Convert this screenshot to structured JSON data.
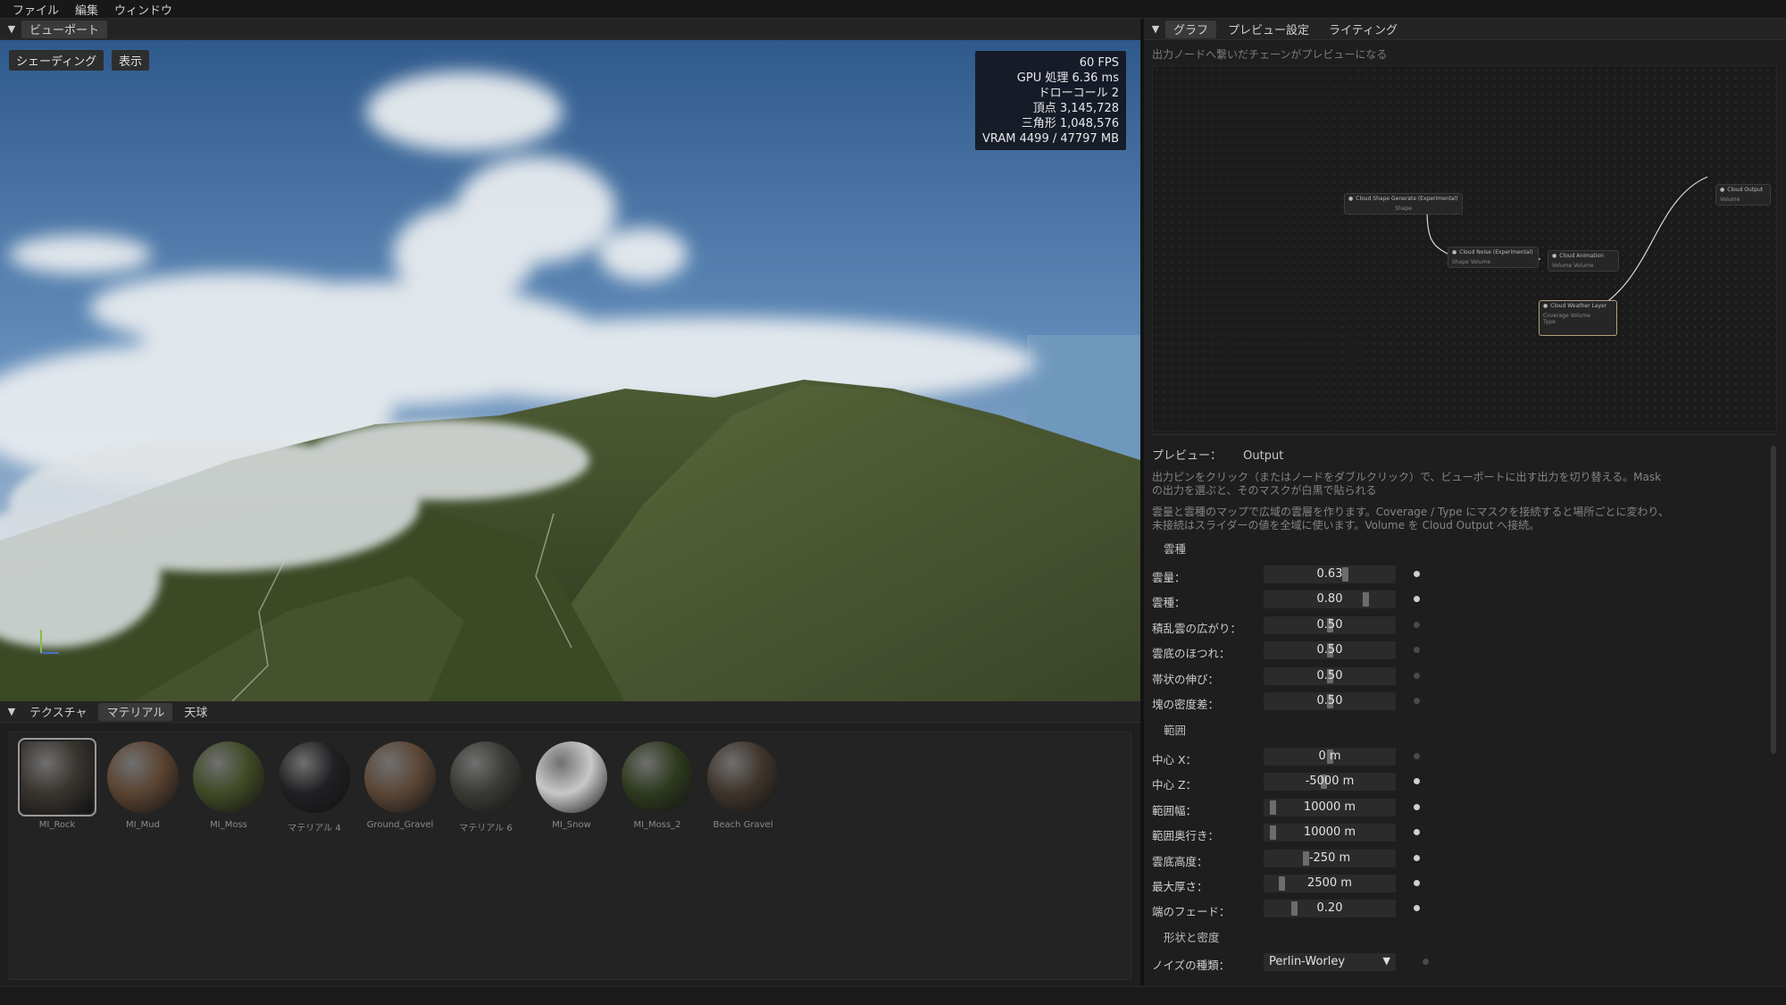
{
  "menu": [
    "ファイル",
    "編集",
    "ウィンドウ"
  ],
  "viewport_panel": {
    "tab": "ビューポート",
    "shading_button": "シェーディング",
    "display_button": "表示",
    "stats": [
      "60 FPS",
      "GPU 処理 6.36 ms",
      "ドローコール 2",
      "頂点 3,145,728",
      "三角形 1,048,576",
      "VRAM 4499 / 47797 MB"
    ]
  },
  "bottom_panel": {
    "tabs": [
      "テクスチャ",
      "マテリアル",
      "天球"
    ],
    "active_tab": 1,
    "materials": [
      {
        "name": "MI_Rock",
        "color": "#3a3530",
        "selected": true
      },
      {
        "name": "MI_Mud",
        "color": "#5a4331"
      },
      {
        "name": "MI_Moss",
        "color": "#3f4a26"
      },
      {
        "name": "マテリアル 4",
        "color": "#1f2022"
      },
      {
        "name": "Ground_Gravel",
        "color": "#5b4636"
      },
      {
        "name": "マテリアル 6",
        "color": "#3a3a35"
      },
      {
        "name": "MI_Snow",
        "color": "#c8c8c8"
      },
      {
        "name": "MI_Moss_2",
        "color": "#2e3a1e"
      },
      {
        "name": "Beach Gravel",
        "color": "#3e342c"
      }
    ]
  },
  "right_panel": {
    "tabs": [
      "グラフ",
      "プレビュー設定",
      "ライティング"
    ],
    "active_tab": 0,
    "hint": "出力ノードへ繋いだチェーンがプレビューになる",
    "nodes": [
      {
        "title": "Cloud Shape Generate (Experimental)",
        "pins": "Shape"
      },
      {
        "title": "Cloud Noise (Experimental)",
        "pins": "Shape    Volume"
      },
      {
        "title": "Cloud Animation",
        "pins": "Volume     Volume"
      },
      {
        "title": "Cloud Weather Layer",
        "pins": "Coverage    Volume",
        "pins2": "Type"
      },
      {
        "title": "Cloud Output",
        "pins": "Volume"
      }
    ],
    "preview_label": "プレビュー：",
    "preview_value": "Output",
    "desc1": [
      "出力ピンをクリック（またはノードをダブルクリック）で、ビューポートに出す出力を切り替える。Mask",
      "の出力を選ぶと、そのマスクが白黒で貼られる"
    ],
    "desc2": [
      "雲量と雲種のマップで広域の雲層を作ります。Coverage / Type にマスクを接続すると場所ごとに変わり、",
      "未接続はスライダーの値を全域に使います。Volume を Cloud Output へ接続。"
    ],
    "sections": [
      "雲種",
      "範囲",
      "形状と密度"
    ],
    "props1": [
      {
        "label": "雲量：",
        "value": "0.63",
        "frac": 0.63,
        "active": true
      },
      {
        "label": "雲種：",
        "value": "0.80",
        "frac": 0.8,
        "active": true
      },
      {
        "label": "積乱雲の広がり：",
        "value": "0.50",
        "frac": 0.5,
        "active": false
      },
      {
        "label": "雲底のほつれ：",
        "value": "0.50",
        "frac": 0.5,
        "active": false
      },
      {
        "label": "帯状の伸び：",
        "value": "0.50",
        "frac": 0.5,
        "active": false
      },
      {
        "label": "塊の密度差：",
        "value": "0.50",
        "frac": 0.5,
        "active": false
      }
    ],
    "props2": [
      {
        "label": "中心 X：",
        "value": "0 m",
        "frac": 0.5,
        "active": false
      },
      {
        "label": "中心 Z：",
        "value": "-5000 m",
        "frac": 0.45,
        "active": true
      },
      {
        "label": "範囲幅：",
        "value": "10000 m",
        "frac": 0.02,
        "active": true
      },
      {
        "label": "範囲奥行き：",
        "value": "10000 m",
        "frac": 0.02,
        "active": true
      },
      {
        "label": "雲底高度：",
        "value": "-250 m",
        "frac": 0.3,
        "active": true
      },
      {
        "label": "最大厚さ：",
        "value": "2500 m",
        "frac": 0.1,
        "active": true
      },
      {
        "label": "端のフェード：",
        "value": "0.20",
        "frac": 0.2,
        "active": true
      }
    ],
    "noise_label": "ノイズの種類：",
    "noise_value": "Perlin-Worley"
  }
}
